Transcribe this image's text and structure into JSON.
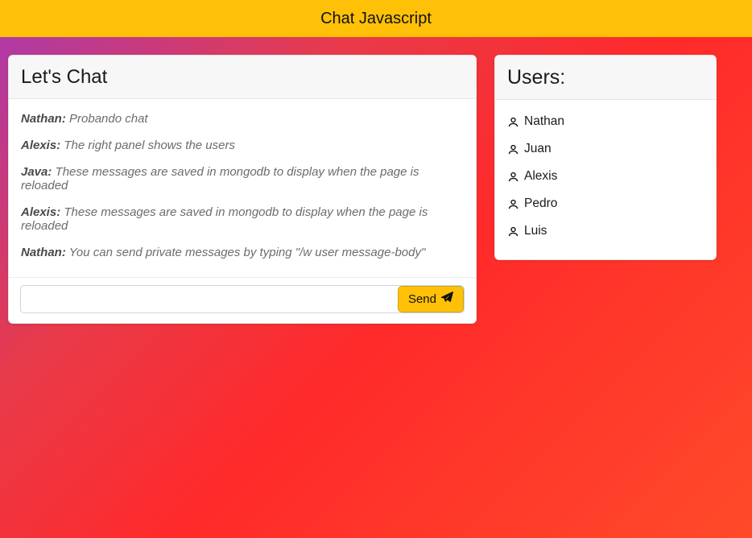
{
  "header": {
    "title": "Chat Javascript"
  },
  "chat": {
    "title": "Let's Chat",
    "messages": [
      {
        "author": "Nathan:",
        "body": "Probando chat"
      },
      {
        "author": "Alexis:",
        "body": "The right panel shows the users"
      },
      {
        "author": "Java:",
        "body": "These messages are saved in mongodb to display when the page is reloaded"
      },
      {
        "author": "Alexis:",
        "body": "These messages are saved in mongodb to display when the page is reloaded"
      },
      {
        "author": "Nathan:",
        "body": "You can send private messages by typing \"/w user message-body\""
      }
    ],
    "input_placeholder": "",
    "send_label": "Send"
  },
  "users_panel": {
    "title": "Users:",
    "users": [
      "Nathan",
      "Juan",
      "Alexis",
      "Pedro",
      "Luis"
    ]
  },
  "colors": {
    "accent": "#ffc107"
  }
}
